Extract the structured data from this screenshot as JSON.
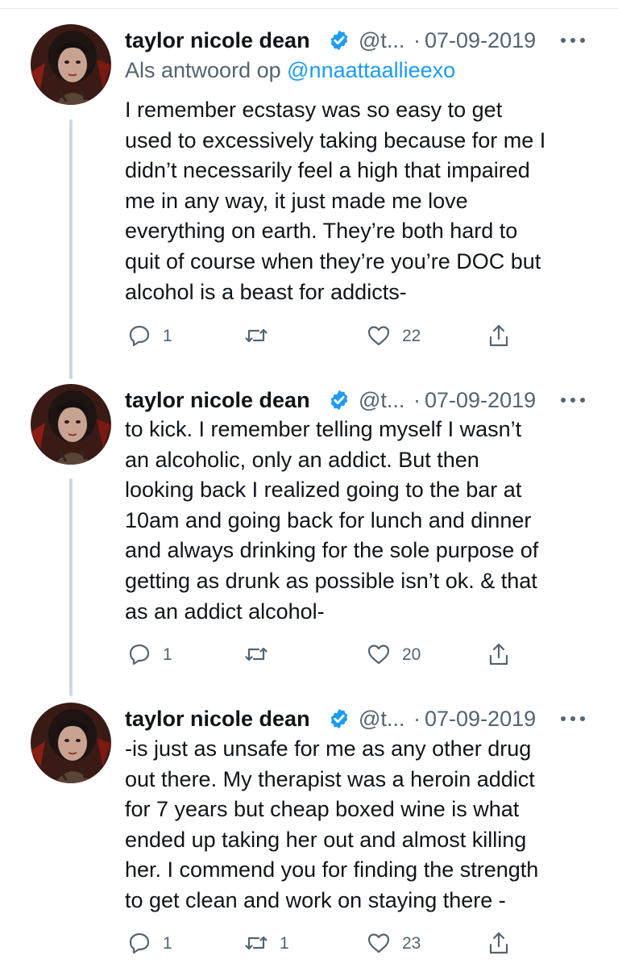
{
  "tweets": [
    {
      "author_name": "taylor nicole dean",
      "handle": "@t...",
      "separator": "·",
      "date": "07-09-2019",
      "reply_prefix": "Als antwoord op",
      "reply_mention": "@nnaattaallieexo",
      "lines": [
        "I remember ecstasy was so easy to get",
        "used to excessively taking because for me I",
        "didn’t necessarily feel a high that impaired",
        "me in any way, it just made me love",
        "everything on earth. They’re both hard to",
        "quit of course when they’re you’re DOC but",
        "alcohol is a beast for addicts-"
      ],
      "reply_count": "1",
      "retweet_count": "",
      "like_count": "22"
    },
    {
      "author_name": "taylor nicole dean",
      "handle": "@t...",
      "separator": "·",
      "date": "07-09-2019",
      "lines": [
        "to kick. I remember telling myself I wasn’t",
        "an alcoholic, only an addict. But then",
        "looking back I realized going to the bar at",
        "10am and going back for lunch and dinner",
        "and always drinking for the sole purpose of",
        "getting as drunk as possible isn’t ok. & that",
        "as an addict alcohol-"
      ],
      "reply_count": "1",
      "retweet_count": "",
      "like_count": "20"
    },
    {
      "author_name": "taylor nicole dean",
      "handle": "@t...",
      "separator": "·",
      "date": "07-09-2019",
      "lines": [
        "-is just as unsafe for me as any other drug",
        "out there. My therapist was a heroin addict",
        "for 7 years but cheap boxed wine is what",
        "ended up taking her out and almost killing",
        "her. I commend you for finding the strength",
        "to get clean and work on staying there -"
      ],
      "reply_count": "1",
      "retweet_count": "1",
      "like_count": "23"
    }
  ],
  "icons": {
    "verified": "verified-badge-icon",
    "more": "more-options-icon",
    "reply": "reply-icon",
    "retweet": "retweet-icon",
    "like": "like-icon",
    "share": "share-icon"
  },
  "colors": {
    "text": "#0f1419",
    "secondary": "#536471",
    "mention": "#1d9bf0",
    "verified": "#1d9bf0",
    "thread_line": "#cfd9de"
  }
}
